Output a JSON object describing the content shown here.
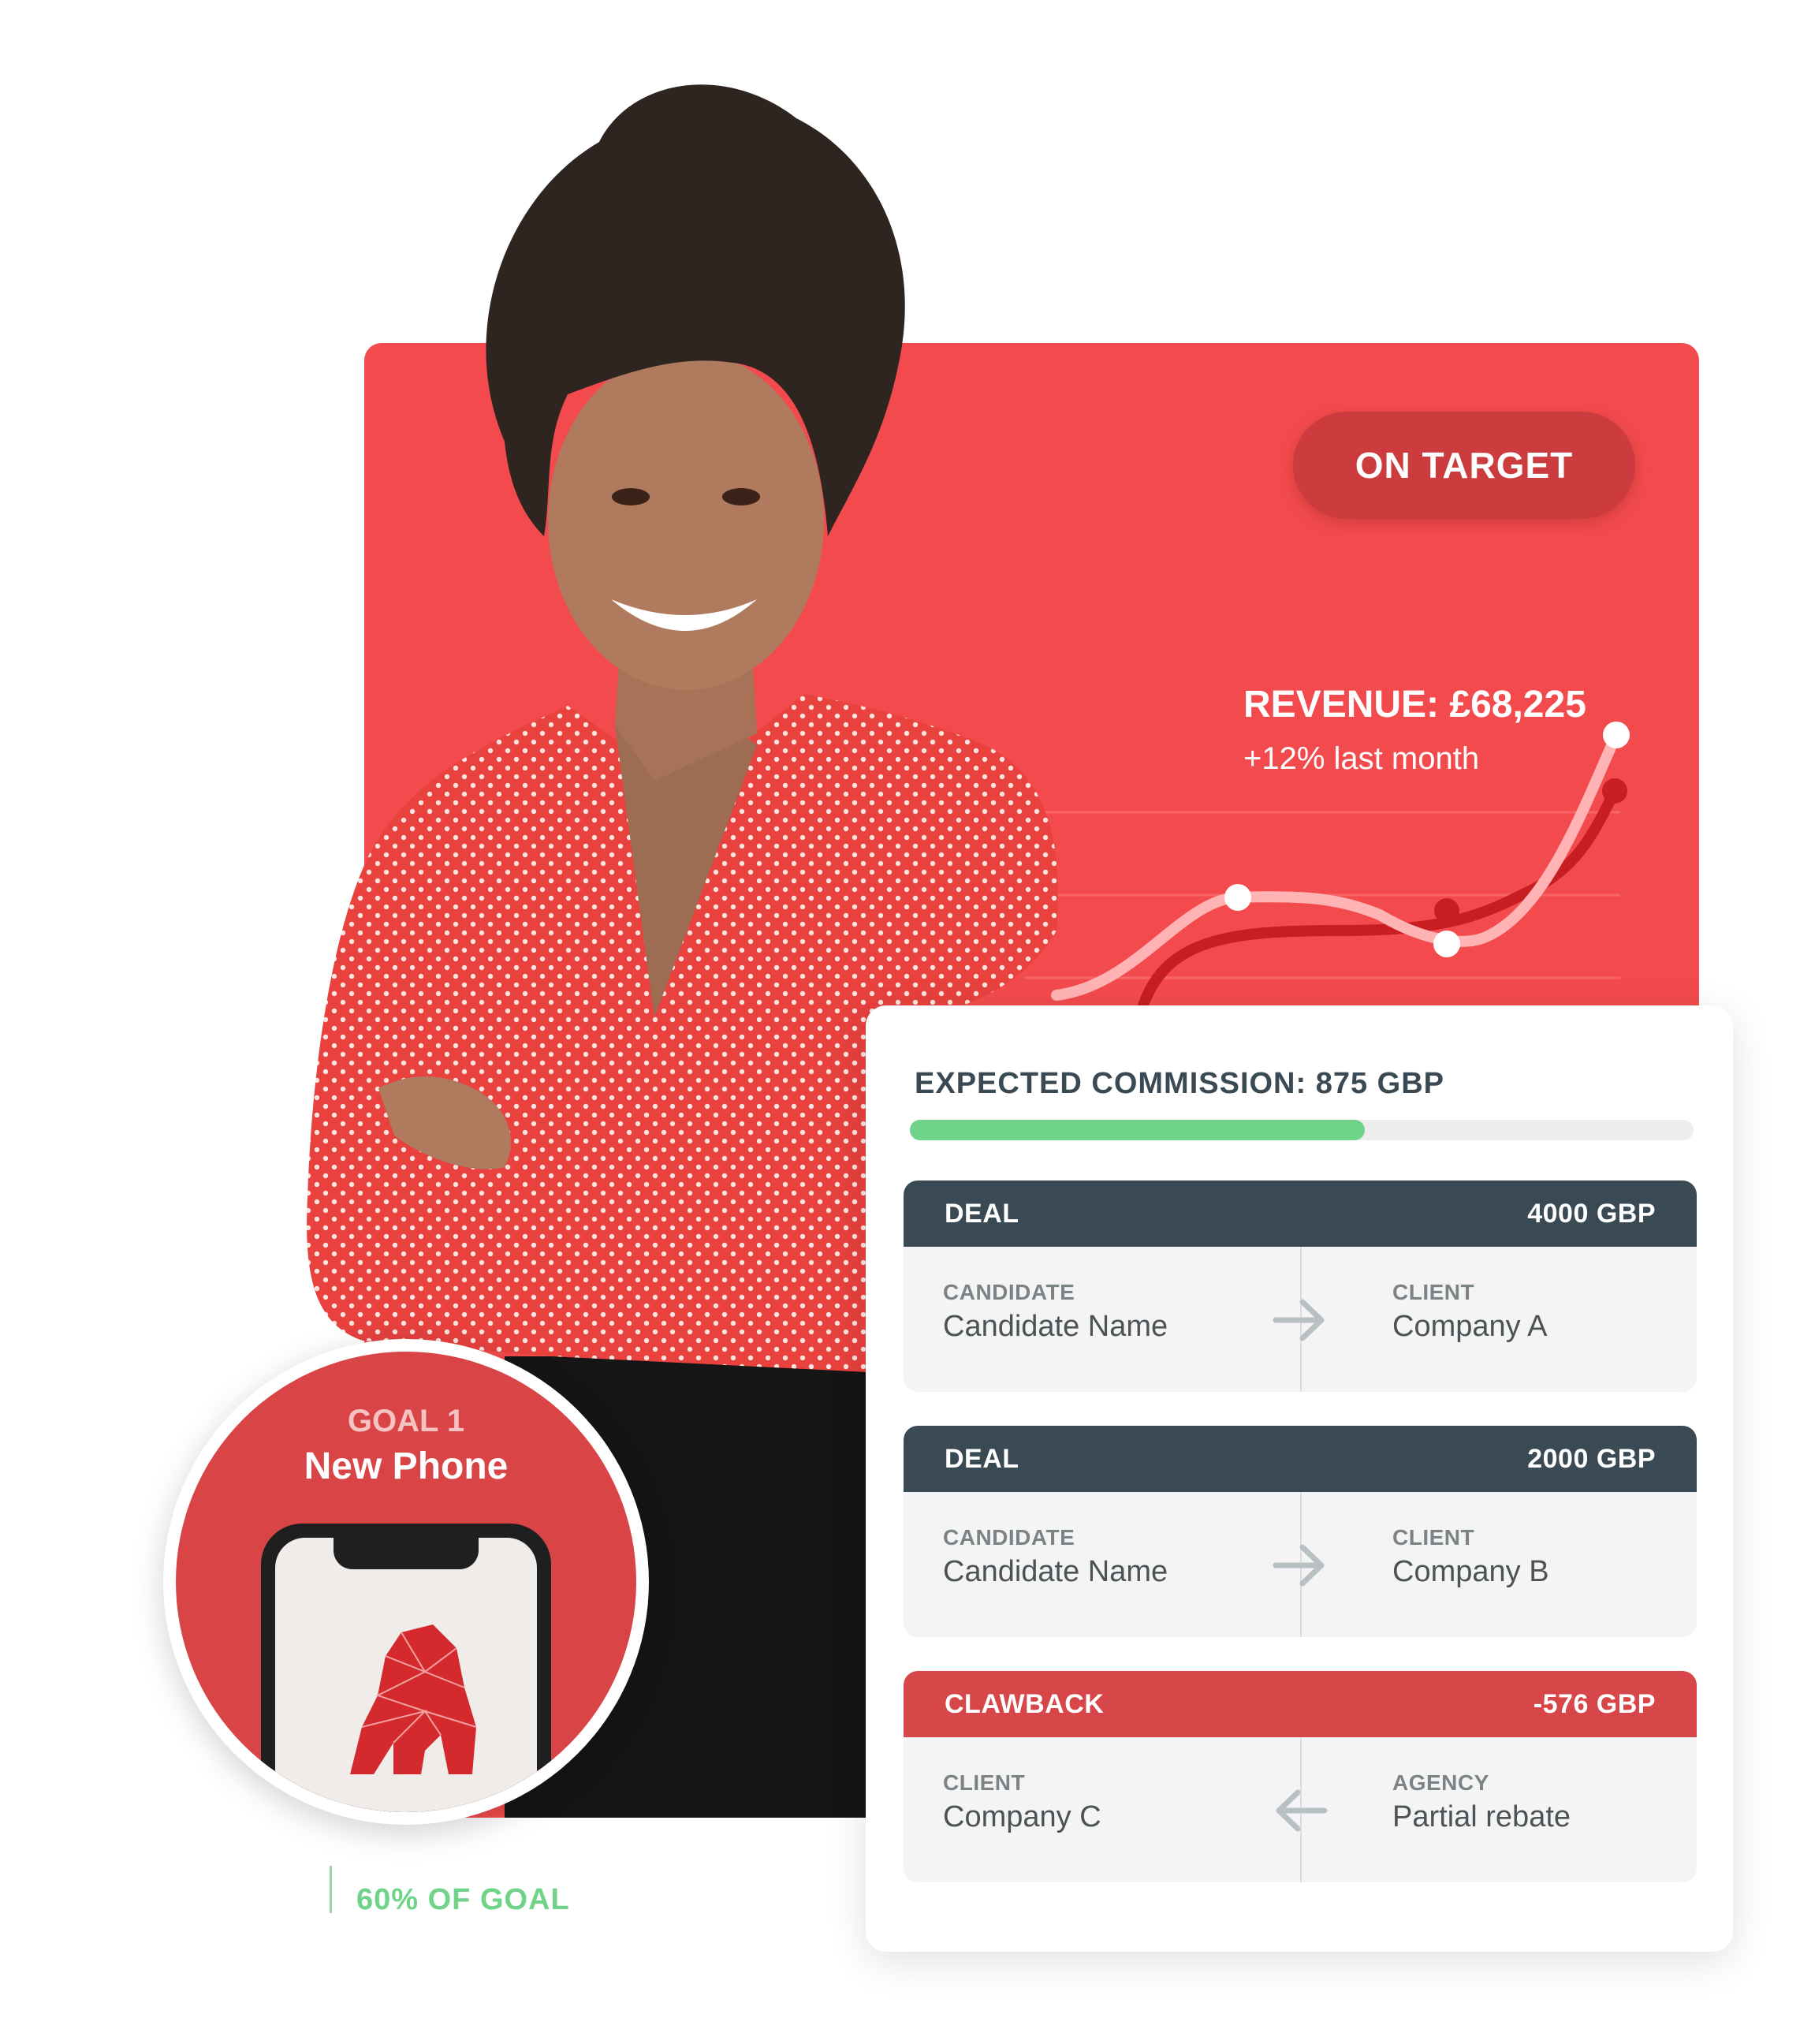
{
  "colors": {
    "accent_red": "#f34b4d",
    "badge_red": "#cc3b3e",
    "goal_red": "#d94447",
    "dark_slate": "#3a4a54",
    "accent_green": "#6fd38a",
    "clawback_red": "#d7474a"
  },
  "revenue": {
    "badge": "ON TARGET",
    "title": "REVENUE: £68,225",
    "subtitle": "+12% last month"
  },
  "goal": {
    "label": "GOAL 1",
    "name": "New Phone",
    "progress_text": "60% OF GOAL",
    "progress_value": 0.6,
    "phone_logo_icon": "gorilla-icon"
  },
  "commission": {
    "title": "EXPECTED COMMISSION: 875 GBP",
    "progress_value": 0.58,
    "entries": [
      {
        "type": "DEAL",
        "amount": "4000 GBP",
        "header_color": "#3a4a54",
        "left_label": "CANDIDATE",
        "left_value": "Candidate Name",
        "right_label": "CLIENT",
        "right_value": "Company A",
        "arrow_icon": "arrow-right-icon"
      },
      {
        "type": "DEAL",
        "amount": "2000 GBP",
        "header_color": "#3a4a54",
        "left_label": "CANDIDATE",
        "left_value": "Candidate Name",
        "right_label": "CLIENT",
        "right_value": "Company B",
        "arrow_icon": "arrow-right-icon"
      },
      {
        "type": "CLAWBACK",
        "amount": "-576 GBP",
        "header_color": "#d7474a",
        "left_label": "CLIENT",
        "left_value": "Company C",
        "right_label": "AGENCY",
        "right_value": "Partial rebate",
        "arrow_icon": "arrow-left-icon"
      }
    ]
  }
}
